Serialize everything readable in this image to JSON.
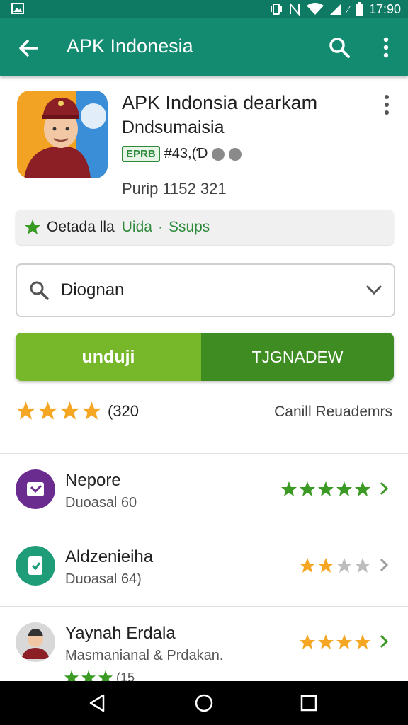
{
  "status_bar": {
    "time": "17:90",
    "icons": [
      "image-icon",
      "vibrate-icon",
      "no-sim-icon",
      "wifi-icon",
      "signal-icon",
      "battery-icon"
    ]
  },
  "appbar": {
    "title": "APK Indonesia",
    "back_icon": "arrow-left-icon",
    "search_icon": "search-icon",
    "more_icon": "more-vert-icon"
  },
  "app": {
    "name": "APK Indonsia dearkam",
    "developer": "Dndsumaisia",
    "badge": "EPRB",
    "badge_text": "#43,(Ɗ",
    "installs": "Purip 1152 321"
  },
  "banner": {
    "text1": "Oetada lla",
    "text2": "Uida",
    "separator": "·",
    "text3": "Ssups"
  },
  "dropdown": {
    "value": "Diognan"
  },
  "buttons": {
    "left": "unduji",
    "right": "TJGNADEW"
  },
  "rating": {
    "stars": 4,
    "count": "(320",
    "link": "Canill Reuademrs"
  },
  "list": [
    {
      "name": "Nepore",
      "sub": "Duoasal 60",
      "rating": 5,
      "icon_color": "#6a2d8f",
      "star_color": "#3a9a24"
    },
    {
      "name": "Aldzenieiha",
      "sub": "Duoasal 64)",
      "rating": 2,
      "icon_color": "#1f9c78",
      "star_color": "#f5a623"
    },
    {
      "name": "Yaynah Erdala",
      "sub": "Masmanianal & Prdakan.",
      "rating": 4,
      "icon_color": "#d8d8d8",
      "star_color": "#f5a623"
    }
  ],
  "list_partial": {
    "stars": 3,
    "count": "(15"
  },
  "colors": {
    "appbar": "#138b71",
    "statusbar": "#0f7a63",
    "green": "#3a9a24",
    "orange": "#f5a623"
  }
}
